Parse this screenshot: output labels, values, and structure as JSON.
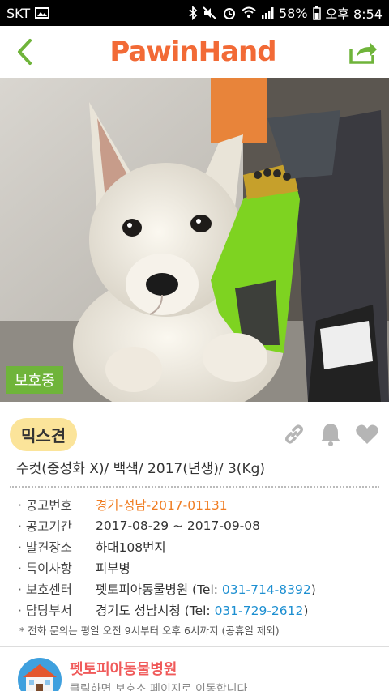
{
  "status": {
    "carrier": "SKT",
    "battery": "58%",
    "time": "오후 8:54"
  },
  "header": {
    "logo": "PawinHand"
  },
  "hero": {
    "badge": "보호중"
  },
  "animal": {
    "breed": "믹스견",
    "summary": "수컷(중성화 X)/ 백색/ 2017(년생)/ 3(Kg)"
  },
  "details": [
    {
      "label": "공고번호",
      "value": "경기-성남-2017-01131"
    },
    {
      "label": "공고기간",
      "value": "2017-08-29 ~ 2017-09-08"
    },
    {
      "label": "발견장소",
      "value": "하대108번지"
    },
    {
      "label": "특이사항",
      "value": "피부병"
    },
    {
      "label": "보호센터",
      "value": "펫토피아동물병원",
      "tel_prefix": "(Tel: ",
      "tel": "031-714-8392",
      "tel_suffix": ")"
    },
    {
      "label": "담당부서",
      "value": "경기도 성남시청",
      "tel_prefix": "(Tel: ",
      "tel": "031-729-2612",
      "tel_suffix": ")"
    }
  ],
  "note": "* 전화 문의는 평일 오전 9시부터 오후 6시까지 (공휴일 제외)",
  "bottom": {
    "name": "펫토피아동물병원",
    "sub": "클릭하면 보호소 페이지로 이동합니다"
  },
  "colors": {
    "brand": "#f26a36",
    "accent_green": "#6fb43a",
    "link": "#1d8fd1",
    "pill": "#fbe49a"
  }
}
